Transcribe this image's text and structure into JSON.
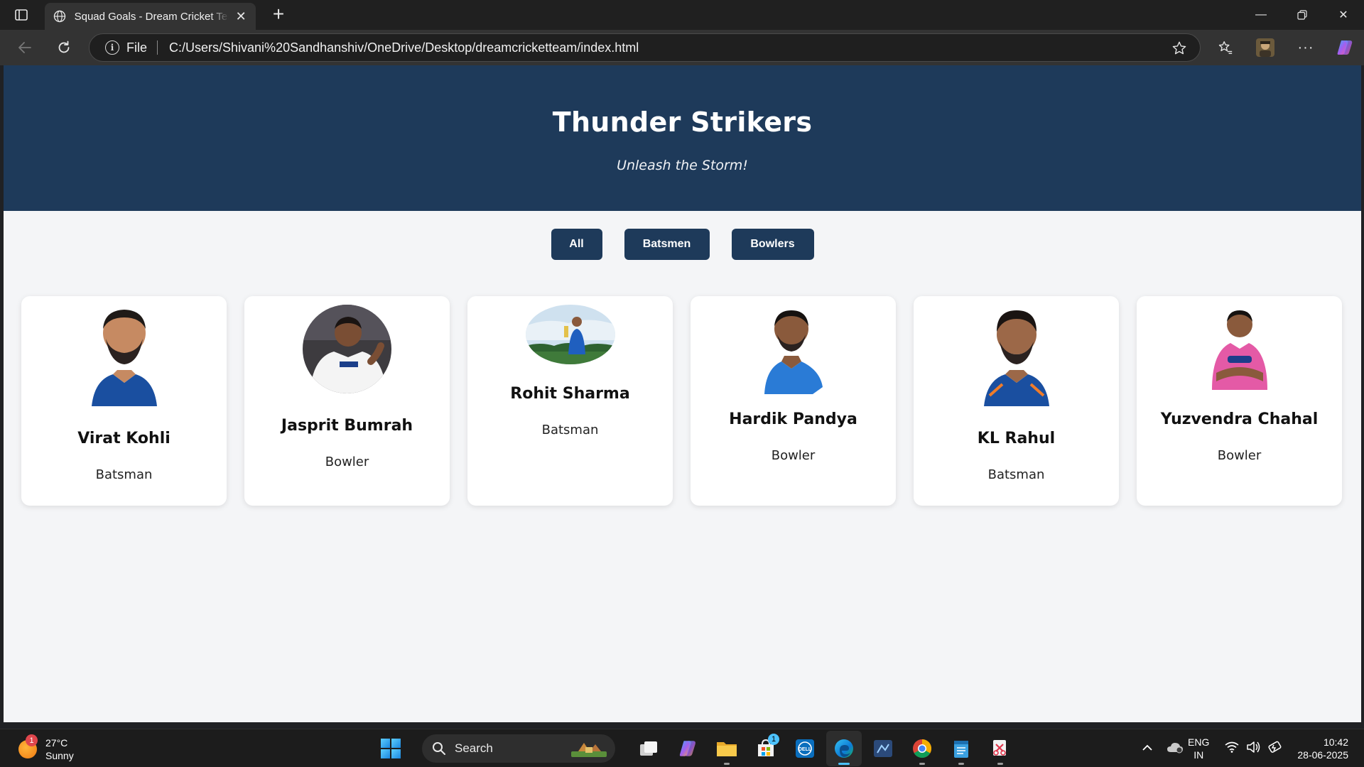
{
  "browser": {
    "tab_title": "Squad Goals - Dream Cricket Team",
    "address_scheme": "File",
    "address_url": "C:/Users/Shivani%20Sandhanshiv/OneDrive/Desktop/dreamcricketteam/index.html"
  },
  "page": {
    "title": "Thunder Strikers",
    "tagline": "Unleash the Storm!",
    "filters": [
      "All",
      "Batsmen",
      "Bowlers"
    ],
    "players": [
      {
        "name": "Virat Kohli",
        "role": "Batsman",
        "jersey": "#1a4fa0"
      },
      {
        "name": "Jasprit Bumrah",
        "role": "Bowler",
        "jersey": "#f4f4f4"
      },
      {
        "name": "Rohit Sharma",
        "role": "Batsman",
        "jersey": "#1f5fbf"
      },
      {
        "name": "Hardik Pandya",
        "role": "Bowler",
        "jersey": "#2a7bd6"
      },
      {
        "name": "KL Rahul",
        "role": "Batsman",
        "jersey": "#1a4fa0"
      },
      {
        "name": "Yuzvendra Chahal",
        "role": "Bowler",
        "jersey": "#e45aa6"
      }
    ]
  },
  "taskbar": {
    "weather_temp": "27°C",
    "weather_desc": "Sunny",
    "weather_badge": "1",
    "search_label": "Search",
    "store_badge": "1",
    "lang_line1": "ENG",
    "lang_line2": "IN",
    "time": "10:42",
    "date": "28-06-2025"
  },
  "colors": {
    "header_bg": "#1e3a5a",
    "page_bg": "#f4f5f7",
    "button_bg": "#1e3a5a"
  }
}
